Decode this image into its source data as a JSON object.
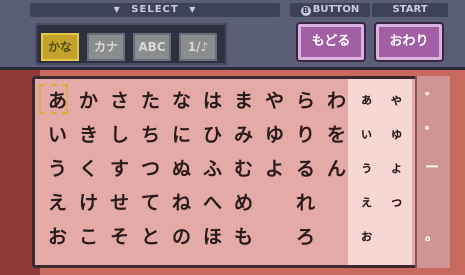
{
  "header": {
    "select_label": "SELECT",
    "bbutton_label": "BUTTON",
    "bbutton_glyph": "B",
    "start_label": "START",
    "arrow_glyph": "▼"
  },
  "modes": [
    {
      "label": "かな",
      "active": true
    },
    {
      "label": "カナ",
      "active": false
    },
    {
      "label": "ABC",
      "active": false
    },
    {
      "label": "1/♪",
      "active": false
    }
  ],
  "buttons": {
    "back_label": "もどる",
    "done_label": "おわり"
  },
  "keyboard": {
    "rows": [
      [
        "あ",
        "か",
        "さ",
        "た",
        "な",
        "は",
        "ま",
        "や",
        "ら",
        "わ"
      ],
      [
        "い",
        "き",
        "し",
        "ち",
        "に",
        "ひ",
        "み",
        "ゆ",
        "り",
        "を"
      ],
      [
        "う",
        "く",
        "す",
        "つ",
        "ぬ",
        "ふ",
        "む",
        "よ",
        "る",
        "ん"
      ],
      [
        "え",
        "け",
        "せ",
        "て",
        "ね",
        "へ",
        "め",
        "",
        "れ",
        ""
      ],
      [
        "お",
        "こ",
        "そ",
        "と",
        "の",
        "ほ",
        "も",
        "",
        "ろ",
        ""
      ]
    ],
    "small_rows": [
      [
        "ぁ",
        "ゃ"
      ],
      [
        "ぃ",
        "ゅ"
      ],
      [
        "ぅ",
        "ょ"
      ],
      [
        "ぇ",
        "っ"
      ],
      [
        "ぉ",
        ""
      ]
    ],
    "controls": [
      "゛",
      "゜",
      "ー",
      "",
      "。"
    ]
  },
  "colors": {
    "active_mode": "#c2a42c",
    "button_purple": "#a35fa4",
    "board_pink": "#e4aaa8"
  }
}
